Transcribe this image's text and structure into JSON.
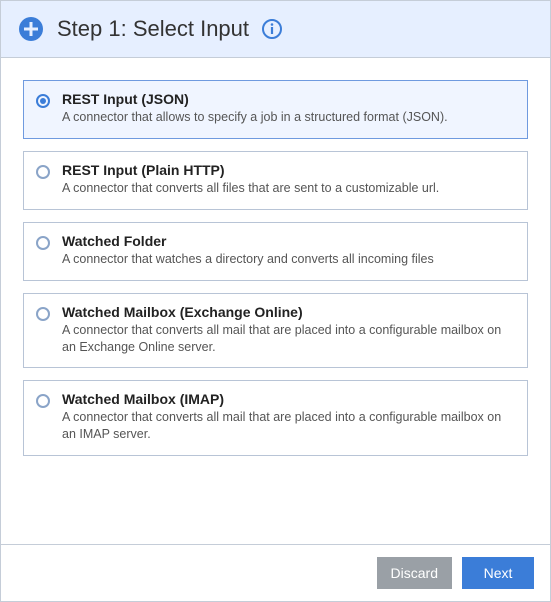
{
  "header": {
    "title": "Step 1: Select Input"
  },
  "options": [
    {
      "title": "REST Input (JSON)",
      "desc": "A connector that allows to specify a job in a structured format (JSON).",
      "selected": true
    },
    {
      "title": "REST Input (Plain HTTP)",
      "desc": "A connector that converts all files that are sent to a customizable url.",
      "selected": false
    },
    {
      "title": "Watched Folder",
      "desc": "A connector that watches a directory and converts all incoming files",
      "selected": false
    },
    {
      "title": "Watched Mailbox (Exchange Online)",
      "desc": "A connector that converts all mail that are placed into a configurable mailbox on an Exchange Online server.",
      "selected": false
    },
    {
      "title": "Watched Mailbox (IMAP)",
      "desc": "A connector that converts all mail that are placed into a configurable mailbox on an IMAP server.",
      "selected": false
    }
  ],
  "footer": {
    "discard_label": "Discard",
    "next_label": "Next"
  }
}
